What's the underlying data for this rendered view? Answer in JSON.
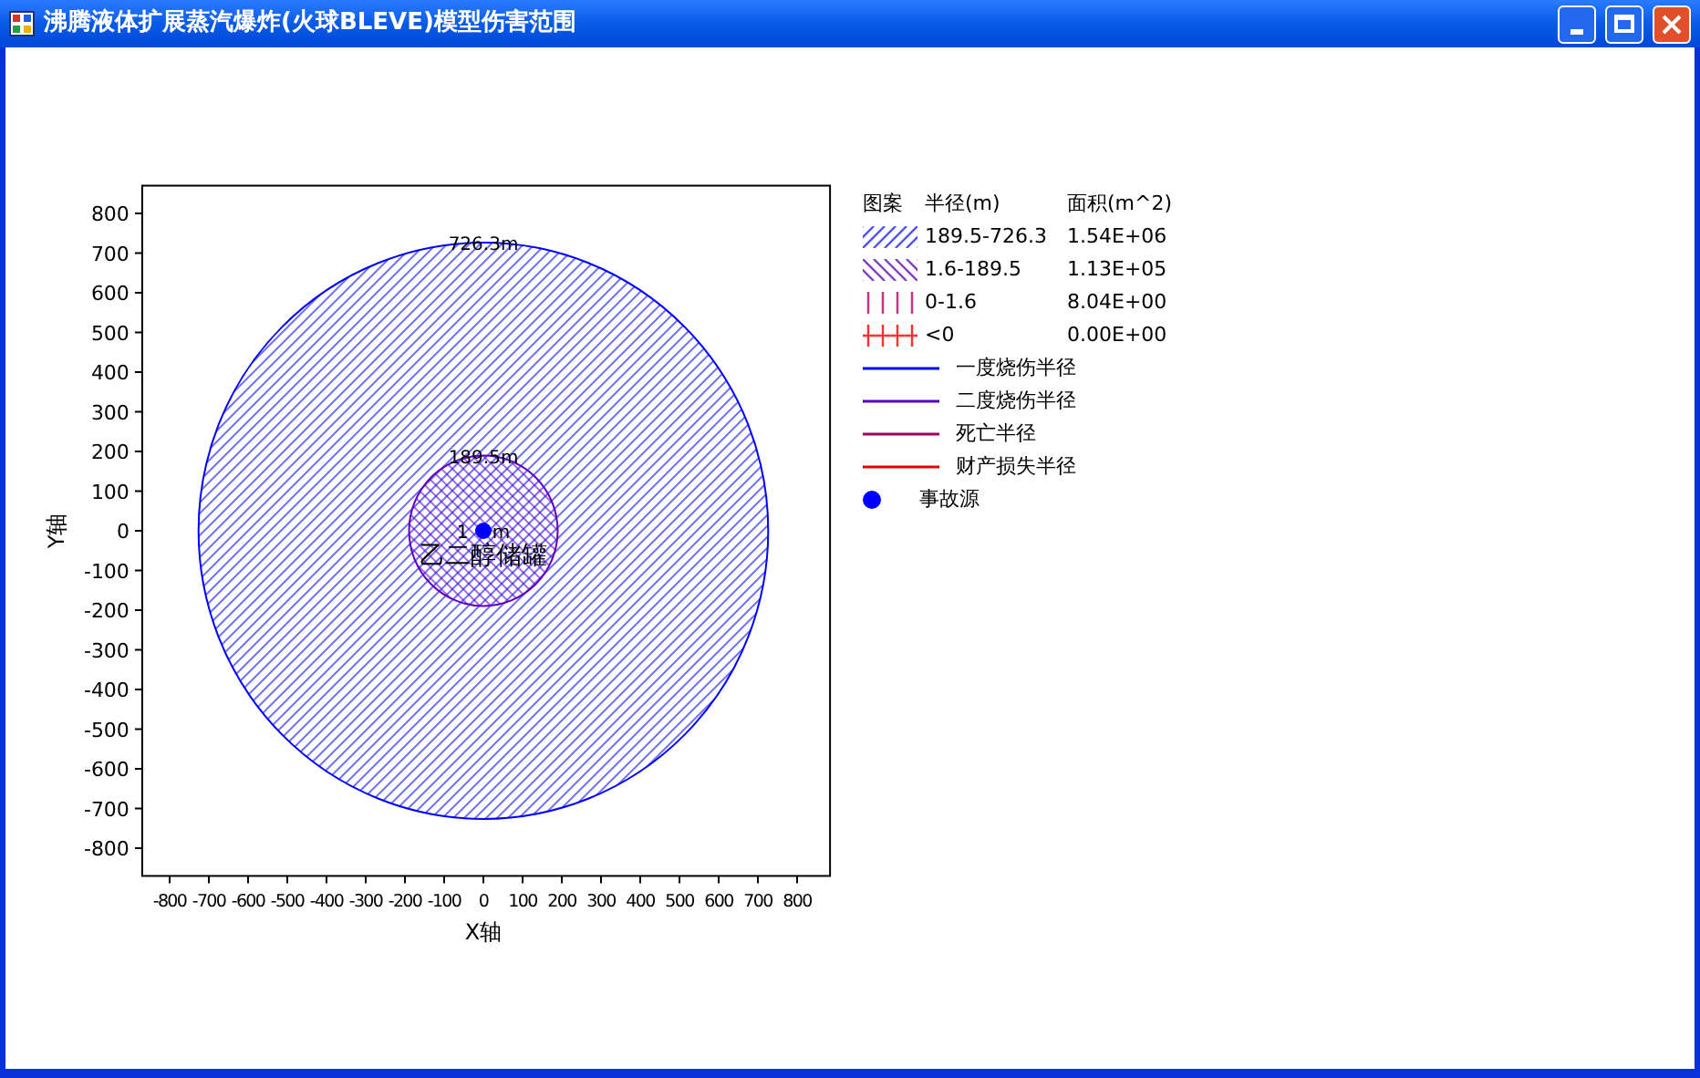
{
  "window": {
    "title": "沸腾液体扩展蒸汽爆炸(火球BLEVE)模型伤害范围"
  },
  "plot": {
    "x_axis_title": "X轴",
    "y_axis_title": "Y轴",
    "x_tick_labels": [
      "-800",
      "-700",
      "-600",
      "-500",
      "-400",
      "-300",
      "-200",
      "-100",
      "0",
      "100",
      "200",
      "300",
      "400",
      "500",
      "600",
      "700",
      "800"
    ],
    "y_tick_labels": [
      "800",
      "700",
      "600",
      "500",
      "400",
      "300",
      "200",
      "100",
      "0",
      "-100",
      "-200",
      "-300",
      "-400",
      "-500",
      "-600",
      "-700",
      "-800"
    ],
    "zones": [
      {
        "kind": "forward_hatch",
        "label": "726.3m",
        "color": "#0000ff"
      },
      {
        "kind": "back_hatch",
        "label": "189.5m",
        "color": "#6000c0"
      },
      {
        "kind": "label_only",
        "label": "1 m"
      }
    ],
    "source": {
      "color": "#0000ff"
    },
    "tank_label": "乙二醇储罐"
  },
  "legend": {
    "header": [
      "图案",
      "半径(m)",
      "面积(m^2)"
    ],
    "items": [
      {
        "kind": "forward_hatch",
        "color": "#5050ff",
        "range": "189.5-726.3",
        "area": "1.54E+06"
      },
      {
        "kind": "back_hatch",
        "color": "#8040c0",
        "range": "1.6-189.5",
        "area": "1.13E+05"
      },
      {
        "kind": "vertical_hatch",
        "color": "#c03080",
        "range": "0-1.6",
        "area": "8.04E+00"
      },
      {
        "kind": "cross_hatch",
        "color": "#ff3030",
        "range": "<0",
        "area": "0.00E+00"
      },
      {
        "kind": "line",
        "color": "#0000ff",
        "label": "一度烧伤半径"
      },
      {
        "kind": "line",
        "color": "#5000c0",
        "label": "二度烧伤半径"
      },
      {
        "kind": "line",
        "color": "#a00060",
        "label": "死亡半径"
      },
      {
        "kind": "line",
        "color": "#e00000",
        "label": "财产损失半径"
      },
      {
        "kind": "dot",
        "color": "#0000ff",
        "label": "事故源"
      }
    ]
  }
}
